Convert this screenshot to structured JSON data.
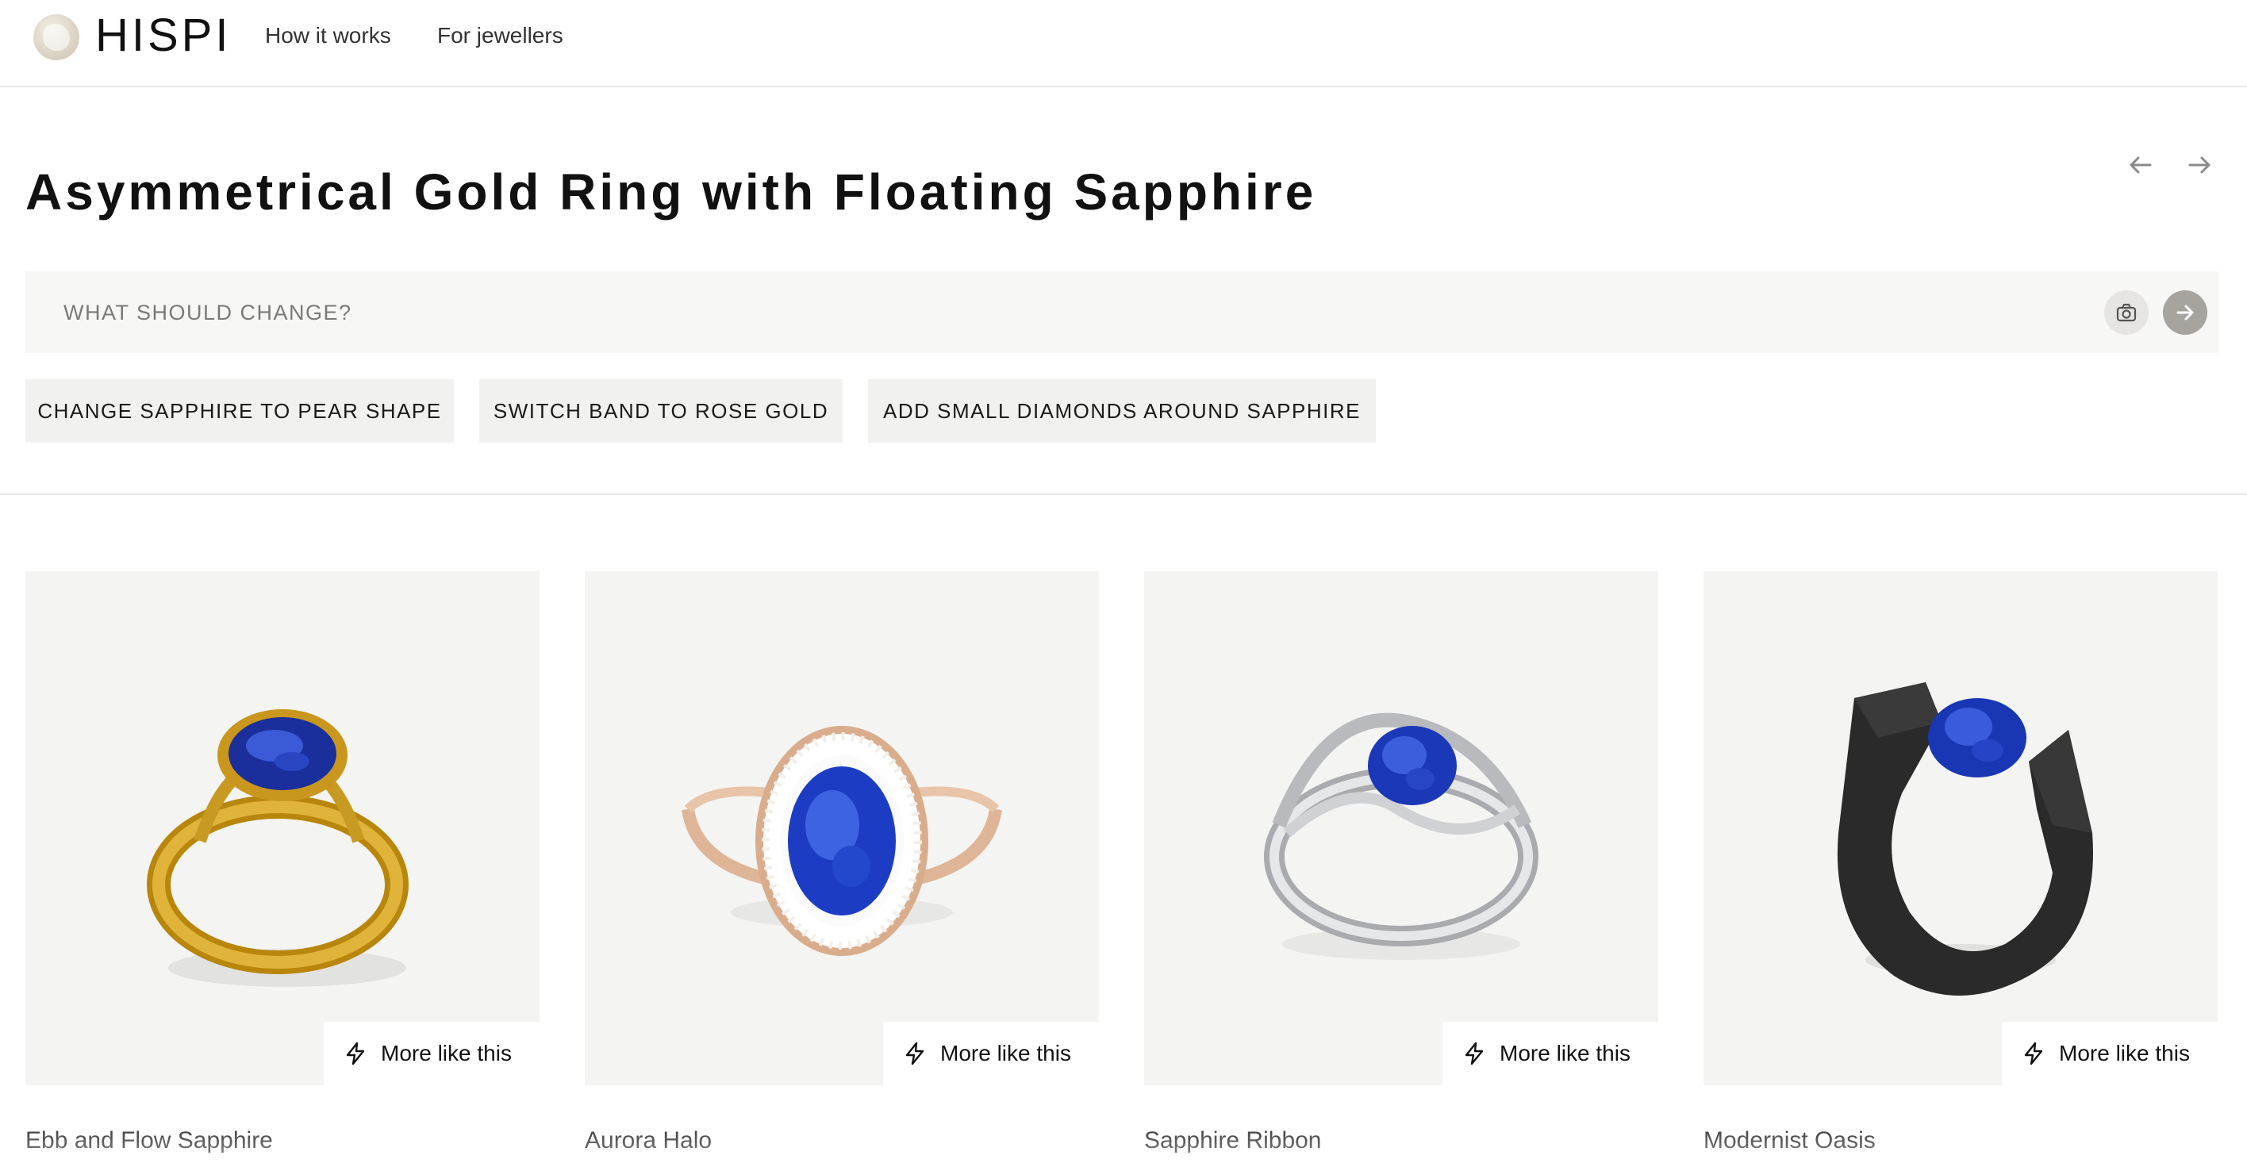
{
  "header": {
    "brand": "HISPI",
    "nav": [
      {
        "label": "How it works"
      },
      {
        "label": "For jewellers"
      }
    ]
  },
  "design": {
    "title": "Asymmetrical Gold Ring with Floating Sapphire"
  },
  "prompt": {
    "placeholder": "WHAT SHOULD CHANGE?"
  },
  "suggestions": [
    {
      "label": "CHANGE SAPPHIRE TO PEAR SHAPE"
    },
    {
      "label": "SWITCH BAND TO ROSE GOLD"
    },
    {
      "label": "ADD SMALL DIAMONDS AROUND SAPPHIRE"
    }
  ],
  "products": [
    {
      "name": "Ebb and Flow Sapphire",
      "action": "More like this"
    },
    {
      "name": "Aurora Halo",
      "action": "More like this"
    },
    {
      "name": "Sapphire Ribbon",
      "action": "More like this"
    },
    {
      "name": "Modernist Oasis",
      "action": "More like this"
    }
  ],
  "colors": {
    "sapphire": "#1e3fb0",
    "gold": "#d4a62a",
    "rose_gold": "#e2b99a",
    "white_gold": "#d9dadc",
    "black_metal": "#2b2b2b"
  },
  "icons": {
    "logo": "pearl-logo-icon",
    "prev": "arrow-left-icon",
    "next": "arrow-right-icon",
    "camera": "camera-icon",
    "send": "arrow-right-circle-icon",
    "more": "lightning-bolt-icon"
  }
}
